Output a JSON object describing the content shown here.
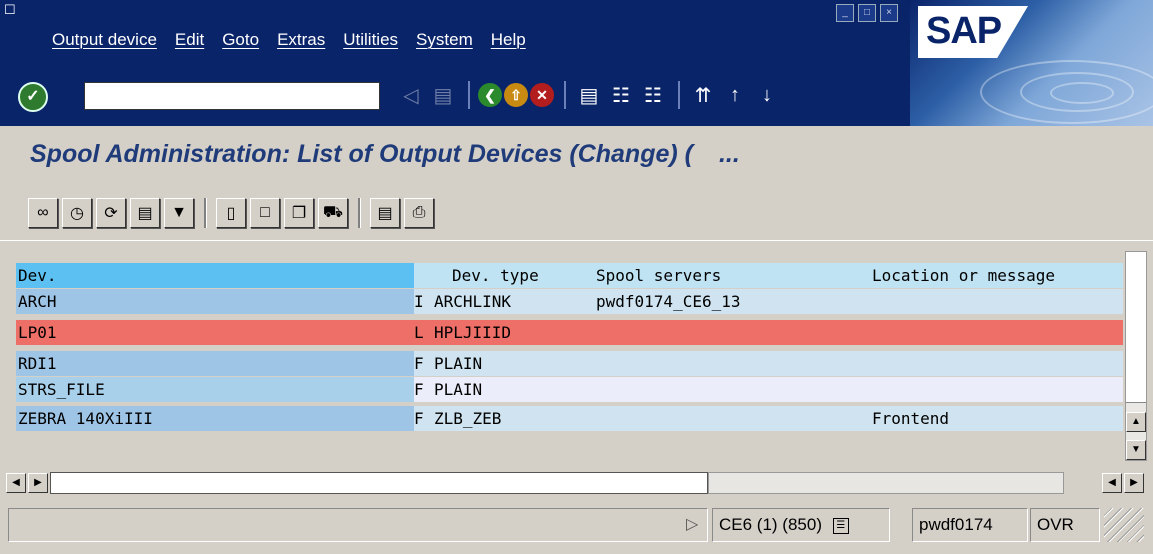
{
  "menu": [
    "Output device",
    "Edit",
    "Goto",
    "Extras",
    "Utilities",
    "System",
    "Help"
  ],
  "logo_text": "SAP",
  "command_field": {
    "value": ""
  },
  "title": {
    "text": "Spool Administration: List of Output Devices  (Change) (",
    "ellipsis": "..."
  },
  "list": {
    "headers": {
      "dev": "Dev.",
      "dev_type": "Dev. type",
      "spool_servers": "Spool servers",
      "location": "Location or message"
    },
    "rows": [
      {
        "dev": "ARCH",
        "class": "I",
        "type": "ARCHLINK",
        "server": "pwdf0174_CE6_13",
        "location": "",
        "style": "blue"
      },
      {
        "dev": "LP01",
        "class": "L",
        "type": "HPLJIIID",
        "server": "",
        "location": "",
        "style": "red"
      },
      {
        "dev": "RDI1",
        "class": "F",
        "type": "PLAIN",
        "server": "",
        "location": "",
        "style": "blue"
      },
      {
        "dev": "STRS_FILE",
        "class": "F",
        "type": "PLAIN",
        "server": "",
        "location": "",
        "style": "light"
      },
      {
        "dev": "ZEBRA 140XiIII",
        "class": "F",
        "type": "ZLB_ZEB",
        "server": "",
        "location": "Frontend",
        "style": "blue"
      }
    ]
  },
  "status": {
    "system": "CE6 (1) (850)",
    "server": "pwdf0174",
    "mode": "OVR"
  },
  "colors": {
    "frame": "#0a246a",
    "header_dev": "#5cc1f2",
    "row_error": "#ee6f67"
  }
}
